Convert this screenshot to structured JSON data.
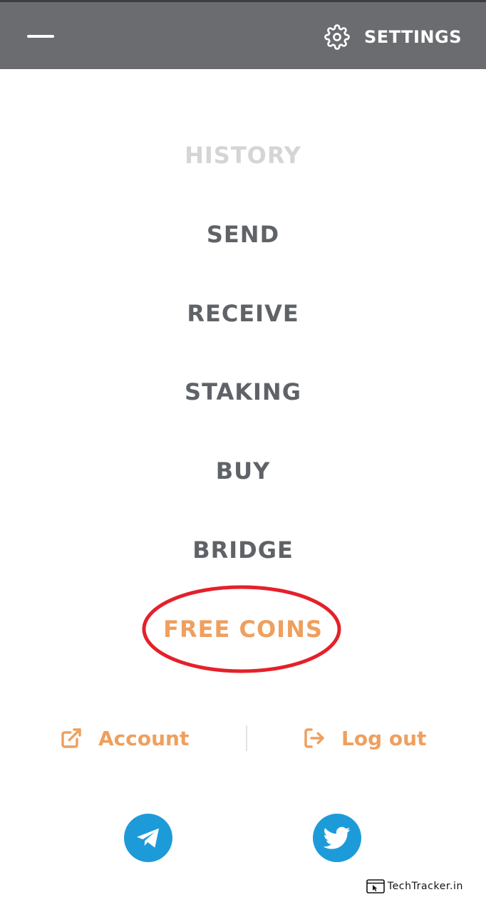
{
  "header": {
    "menu_icon": "hamburger-icon",
    "settings_icon": "gear-icon",
    "settings_label": "SETTINGS"
  },
  "menu": {
    "items": [
      {
        "label": "HISTORY",
        "state": "inactive"
      },
      {
        "label": "SEND",
        "state": "normal"
      },
      {
        "label": "RECEIVE",
        "state": "normal"
      },
      {
        "label": "STAKING",
        "state": "normal"
      },
      {
        "label": "BUY",
        "state": "normal"
      },
      {
        "label": "BRIDGE",
        "state": "normal"
      },
      {
        "label": "FREE COINS",
        "state": "accent"
      }
    ]
  },
  "links": {
    "account_label": "Account",
    "account_icon": "external-link-icon",
    "logout_label": "Log out",
    "logout_icon": "logout-icon"
  },
  "social": {
    "telegram_icon": "telegram-icon",
    "twitter_icon": "twitter-icon"
  },
  "watermark": {
    "text": "TechTracker.in",
    "icon": "browser-cursor-icon"
  },
  "colors": {
    "header_bg": "#6a6c70",
    "menu_text": "#5f6368",
    "menu_inactive": "#d4d5d7",
    "accent": "#ef9f5e",
    "highlight_ring": "#e5202a",
    "social_bg": "#1d9bd9"
  }
}
